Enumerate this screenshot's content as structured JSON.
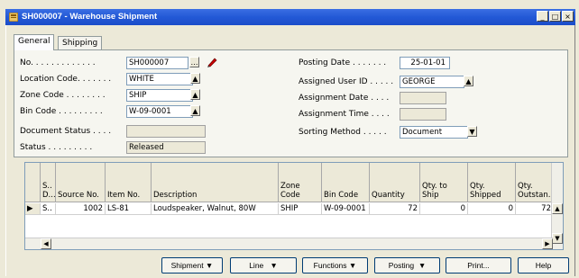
{
  "window": {
    "title": "SH000007 - Warehouse Shipment",
    "controls": [
      "_",
      "□",
      "×"
    ]
  },
  "tabs": [
    "General",
    "Shipping"
  ],
  "general": {
    "no_label": "No. . . . . . . . . . . . .",
    "no_value": "SH000007",
    "location_label": "Location Code. . . . . . .",
    "location_value": "WHITE",
    "zone_label": "Zone Code . . . . . . . .",
    "zone_value": "SHIP",
    "bin_label": "Bin Code . . . . . . . . .",
    "bin_value": "W-09-0001",
    "doc_status_label": "Document Status . . . .",
    "doc_status_value": "",
    "status_label": "Status . . . . . . . . .",
    "status_value": "Released",
    "posting_date_label": "Posting Date . . . . . . .",
    "posting_date_value": "25-01-01",
    "assigned_user_label": "Assigned User ID . . . . .",
    "assigned_user_value": "GEORGE",
    "assignment_date_label": "Assignment Date . . . .",
    "assignment_date_value": "",
    "assignment_time_label": "Assignment Time . . . .",
    "assignment_time_value": "",
    "sorting_label": "Sorting Method . . . . .",
    "sorting_value": "Document"
  },
  "grid": {
    "headers": [
      "S.. D...",
      "Source No.",
      "Item No.",
      "Description",
      "Zone Code",
      "Bin Code",
      "Quantity",
      "Qty. to Ship",
      "Qty. Shipped",
      "Qty. Outstan..."
    ],
    "rows": [
      {
        "marker": "▶",
        "s": "S..",
        "source_no": "1002",
        "item_no": "LS-81",
        "description": "Loudspeaker, Walnut, 80W",
        "zone": "SHIP",
        "bin": "W-09-0001",
        "quantity": "72",
        "qty_to_ship": "0",
        "qty_shipped": "0",
        "qty_outstanding": "72"
      }
    ]
  },
  "buttons": {
    "shipment": "Shipment",
    "line": "Line",
    "functions": "Functions",
    "posting": "Posting",
    "print": "Print...",
    "help": "Help"
  },
  "colors": {
    "titlebar": "#2359d6",
    "background": "#ece9d8"
  },
  "icons": [
    "window-icon",
    "assist-edit-icon",
    "pencil-icon",
    "dropdown-arrow-icon",
    "scroll-arrow-icon",
    "row-selector-icon"
  ]
}
